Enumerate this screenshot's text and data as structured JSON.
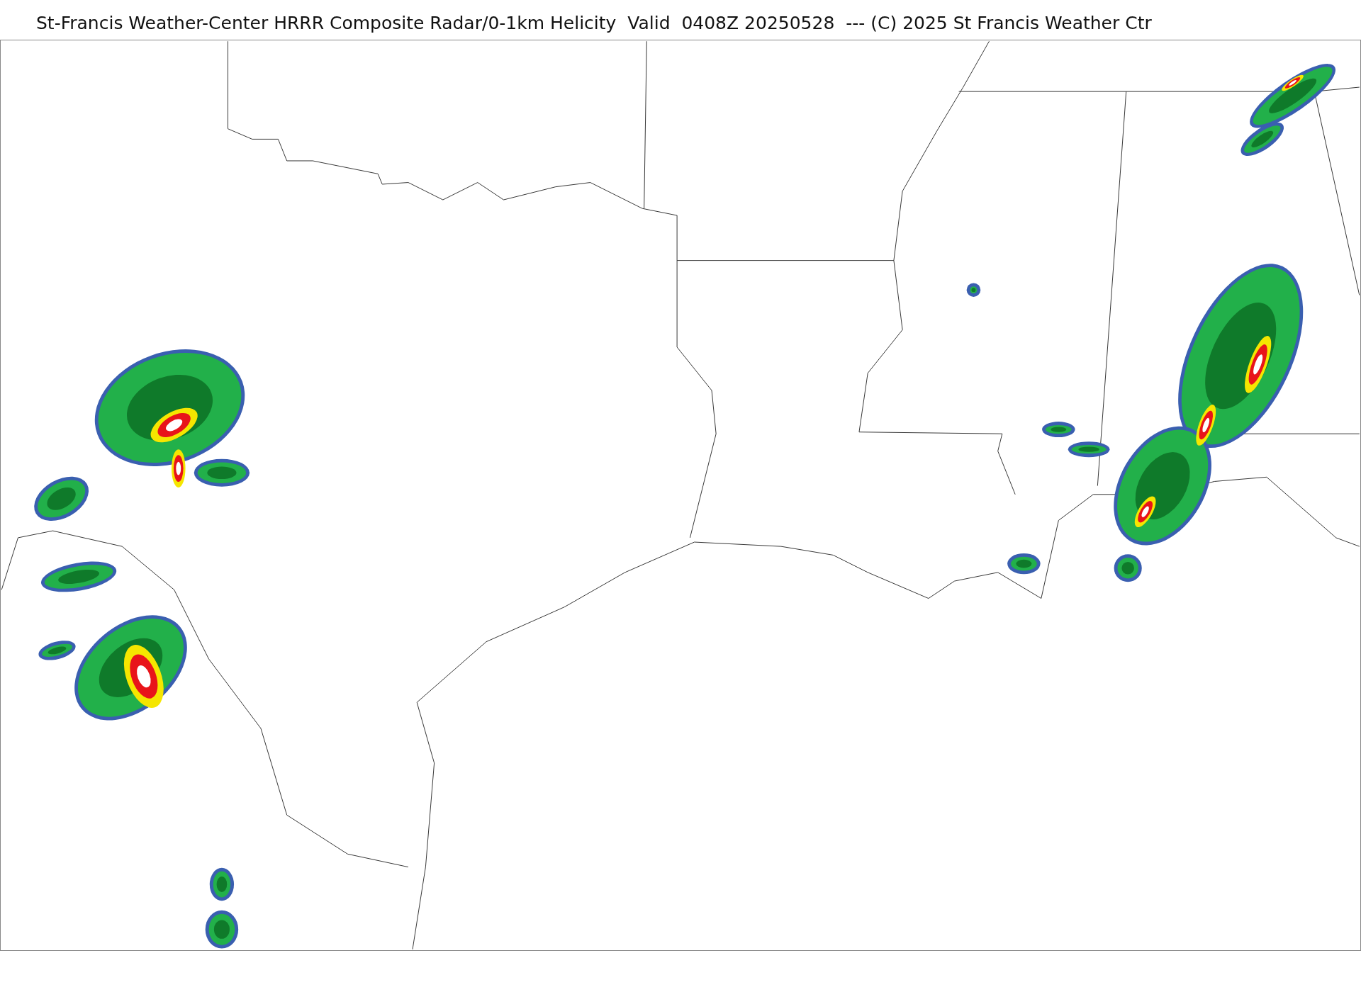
{
  "title": "St-Francis Weather-Center HRRR Composite Radar/0-1km Helicity  Valid  0408Z 20250528  --- (C) 2025 St Francis Weather Ctr"
}
